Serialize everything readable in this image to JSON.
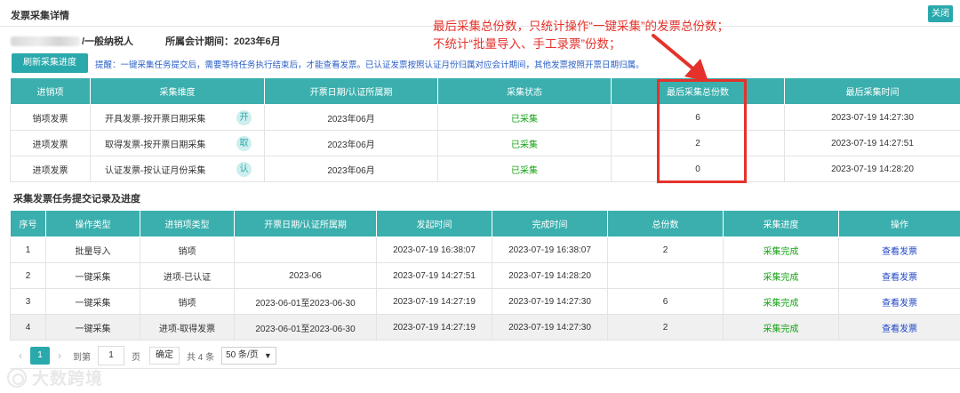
{
  "header": {
    "title": "发票采集详情",
    "close_label": "关闭"
  },
  "company": {
    "taxpayer_type": "/一般纳税人",
    "period": "所属会计期间：2023年6月"
  },
  "toolbar": {
    "refresh_label": "刷新采集进度",
    "hint": "提醒：一键采集任务提交后，需要等待任务执行结束后，才能查看发票。已认证发票按照认证月份归属对应会计期间，其他发票按照开票日期归属。"
  },
  "annotation": {
    "line1": "最后采集总份数，只统计操作“一键采集”的发票总份数；",
    "line2": "不统计“批量导入、手工录票”份数；",
    "color": "#e4322b"
  },
  "summary_table": {
    "headers": [
      "进销项",
      "采集维度",
      "开票日期/认证所属期",
      "采集状态",
      "最后采集总份数",
      "最后采集时间"
    ],
    "rows": [
      {
        "type": "销项发票",
        "dimension": "开具发票-按开票日期采集",
        "badge": "开",
        "period": "2023年06月",
        "status": "已采集",
        "count": "6",
        "time": "2023-07-19 14:27:30"
      },
      {
        "type": "进项发票",
        "dimension": "取得发票-按开票日期采集",
        "badge": "取",
        "period": "2023年06月",
        "status": "已采集",
        "count": "2",
        "time": "2023-07-19 14:27:51"
      },
      {
        "type": "进项发票",
        "dimension": "认证发票-按认证月份采集",
        "badge": "认",
        "period": "2023年06月",
        "status": "已采集",
        "count": "0",
        "time": "2023-07-19 14:28:20"
      }
    ]
  },
  "tasks_section_title": "采集发票任务提交记录及进度",
  "tasks_table": {
    "headers": [
      "序号",
      "操作类型",
      "进销项类型",
      "开票日期/认证所属期",
      "发起时间",
      "完成时间",
      "总份数",
      "采集进度",
      "操作"
    ],
    "rows": [
      {
        "no": "1",
        "op": "批量导入",
        "kind": "销项",
        "period": "",
        "start": "2023-07-19 16:38:07",
        "end": "2023-07-19 16:38:07",
        "total": "2",
        "progress": "采集完成",
        "action": "查看发票"
      },
      {
        "no": "2",
        "op": "一键采集",
        "kind": "进项-已认证",
        "period": "2023-06",
        "start": "2023-07-19 14:27:51",
        "end": "2023-07-19 14:28:20",
        "total": "",
        "progress": "采集完成",
        "action": "查看发票"
      },
      {
        "no": "3",
        "op": "一键采集",
        "kind": "销项",
        "period": "2023-06-01至2023-06-30",
        "start": "2023-07-19 14:27:19",
        "end": "2023-07-19 14:27:30",
        "total": "6",
        "progress": "采集完成",
        "action": "查看发票"
      },
      {
        "no": "4",
        "op": "一键采集",
        "kind": "进项-取得发票",
        "period": "2023-06-01至2023-06-30",
        "start": "2023-07-19 14:27:19",
        "end": "2023-07-19 14:27:30",
        "total": "2",
        "progress": "采集完成",
        "action": "查看发票"
      }
    ]
  },
  "pagination": {
    "prev_icon": "chevron-left-icon",
    "next_icon": "chevron-right-icon",
    "current_page": "1",
    "goto_label": "到第",
    "goto_value": "1",
    "page_unit": "页",
    "confirm_label": "确定",
    "total_label": "共 4 条",
    "page_size": "50 条/页"
  },
  "watermark": {
    "text": "大数跨境",
    "icon": "brand-logo-icon"
  },
  "colors": {
    "accent": "#2aa9ac",
    "header_bg": "#3aafae",
    "success": "#18a318",
    "link": "#2147c4"
  }
}
